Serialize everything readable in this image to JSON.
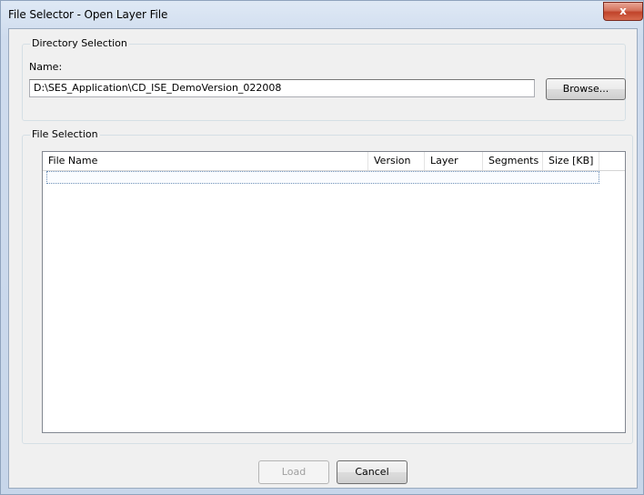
{
  "window": {
    "title": "File Selector - Open Layer File",
    "close_label": "x"
  },
  "directory": {
    "group_title": "Directory Selection",
    "name_label": "Name:",
    "path": "D:\\SES_Application\\CD_ISE_DemoVersion_022008",
    "browse_label": "Browse..."
  },
  "file_selection": {
    "group_title": "File Selection",
    "columns": [
      "File Name",
      "Version",
      "Layer",
      "Segments",
      "Size [KB]"
    ],
    "rows": []
  },
  "footer": {
    "load_label": "Load",
    "cancel_label": "Cancel"
  }
}
